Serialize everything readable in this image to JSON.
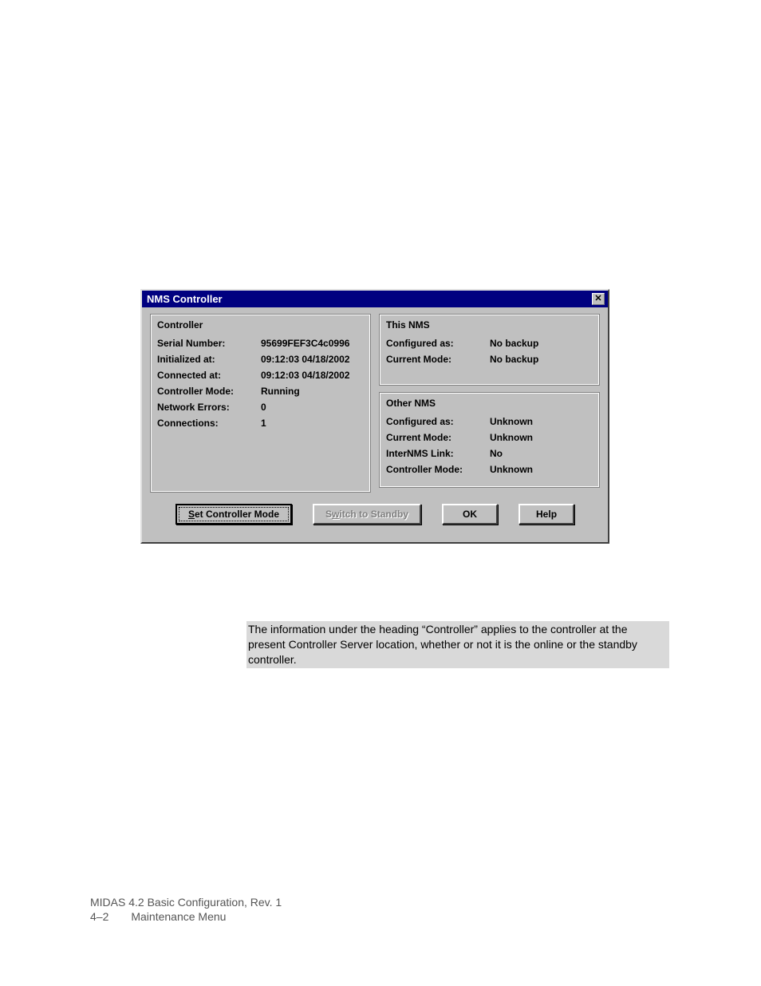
{
  "dialog": {
    "title": "NMS Controller",
    "controller": {
      "legend": "Controller",
      "rows": [
        {
          "label": "Serial Number:",
          "value": "95699FEF3C4c0996"
        },
        {
          "label": "Initialized at:",
          "value": "09:12:03  04/18/2002"
        },
        {
          "label": "Connected at:",
          "value": "09:12:03  04/18/2002"
        },
        {
          "label": "Controller Mode:",
          "value": "Running"
        },
        {
          "label": "Network Errors:",
          "value": "0"
        },
        {
          "label": "Connections:",
          "value": "1"
        }
      ]
    },
    "this_nms": {
      "legend": "This NMS",
      "rows": [
        {
          "label": "Configured as:",
          "value": "No backup"
        },
        {
          "label": "Current Mode:",
          "value": "No backup"
        }
      ]
    },
    "other_nms": {
      "legend": "Other NMS",
      "rows": [
        {
          "label": "Configured as:",
          "value": "Unknown"
        },
        {
          "label": "Current Mode:",
          "value": "Unknown"
        },
        {
          "label": "InterNMS Link:",
          "value": "No"
        },
        {
          "label": "Controller Mode:",
          "value": "Unknown"
        }
      ]
    },
    "buttons": {
      "set_mode": "Set Controller Mode",
      "switch_standby": "Switch to Standby",
      "ok": "OK",
      "help": "Help"
    }
  },
  "note_text": "The information under the heading “Controller” applies to the controller at the present Controller Server location, whether or not it is the online or the standby controller.",
  "footer": {
    "line1": "MIDAS 4.2 Basic Configuration, Rev. 1",
    "page": "4–2",
    "section": "Maintenance Menu"
  }
}
